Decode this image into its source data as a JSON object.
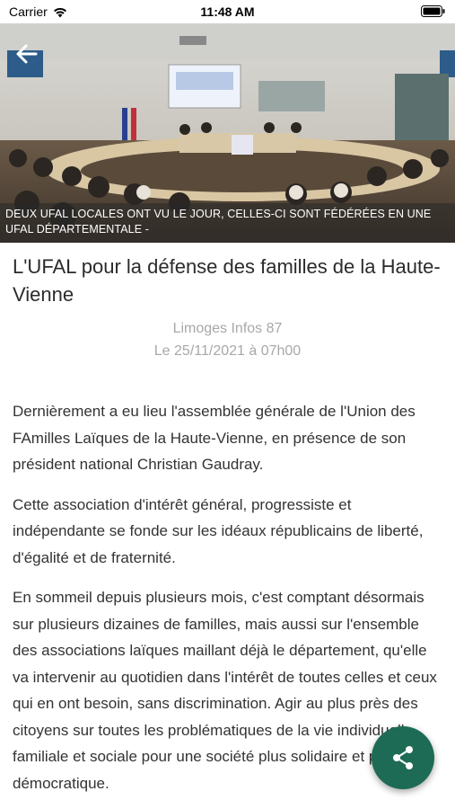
{
  "status_bar": {
    "carrier": "Carrier",
    "time": "11:48 AM"
  },
  "hero": {
    "caption": "DEUX UFAL LOCALES ONT VU LE JOUR, CELLES-CI SONT FÉDÉRÉES EN UNE UFAL DÉPARTEMENTALE -",
    "back_icon": "arrow-left-icon"
  },
  "article": {
    "title": "L'UFAL pour la défense des familles de la Haute-Vienne",
    "source": "Limoges Infos 87",
    "date": "Le 25/11/2021 à 07h00",
    "paragraphs": [
      "Dernièrement a eu lieu l'assemblée générale de l'Union des FAmilles Laïques de la Haute-Vienne, en présence de son président national Christian Gaudray.",
      "Cette association d'intérêt général, progressiste et indépendante se fonde sur les idéaux républicains de liberté, d'égalité et de fraternité.",
      "En sommeil depuis plusieurs mois, c'est comptant désormais sur plusieurs dizaines de familles, mais aussi sur l'ensemble des associations laïques maillant déjà le département, qu'elle va intervenir au quotidien dans l'intérêt de toutes celles et ceux qui en ont besoin, sans discrimination. Agir au plus près des citoyens sur toutes les problématiques de la vie individuelle, familiale et sociale pour une société plus solidaire et plus démocratique."
    ]
  },
  "fab": {
    "icon": "share-icon",
    "color": "#1e6b55"
  }
}
